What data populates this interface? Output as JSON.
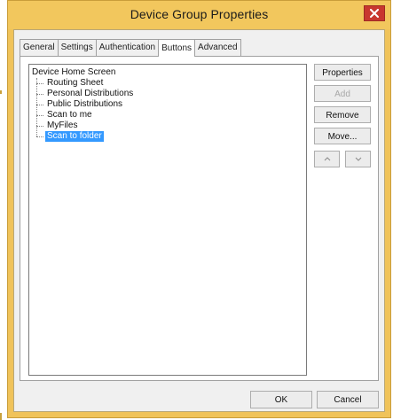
{
  "window": {
    "title": "Device Group Properties",
    "close_glyph": "×"
  },
  "tabs": [
    {
      "label": "General",
      "active": false
    },
    {
      "label": "Settings",
      "active": false
    },
    {
      "label": "Authentication",
      "active": false
    },
    {
      "label": "Buttons",
      "active": true
    },
    {
      "label": "Advanced",
      "active": false
    }
  ],
  "tree": {
    "root": "Device Home Screen",
    "items": [
      {
        "label": "Routing Sheet",
        "selected": false
      },
      {
        "label": "Personal Distributions",
        "selected": false
      },
      {
        "label": "Public Distributions",
        "selected": false
      },
      {
        "label": "Scan to me",
        "selected": false
      },
      {
        "label": "MyFiles",
        "selected": false
      },
      {
        "label": "Scan to folder",
        "selected": true
      }
    ]
  },
  "side_buttons": {
    "properties": "Properties",
    "add": "Add",
    "remove": "Remove",
    "move": "Move...",
    "up_glyph": "^",
    "down_glyph": "v"
  },
  "footer": {
    "ok": "OK",
    "cancel": "Cancel"
  },
  "colors": {
    "titlebar": "#f2c75d",
    "close": "#c8372f",
    "selection": "#3399ff"
  }
}
